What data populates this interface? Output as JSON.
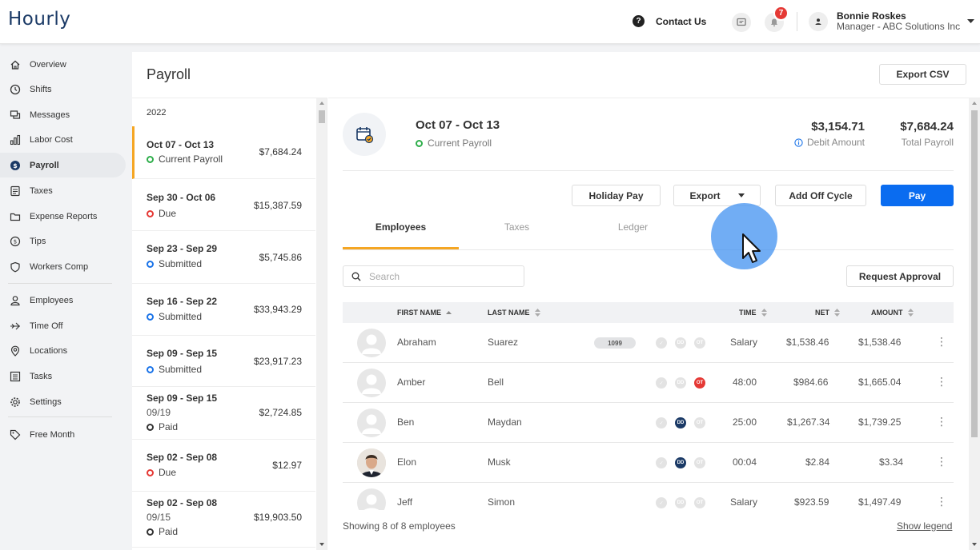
{
  "header": {
    "logo": "Hourly",
    "contact_label": "Contact Us",
    "notification_count": "7",
    "user_name": "Bonnie Roskes",
    "user_role": "Manager - ABC Solutions Inc"
  },
  "sidebar": {
    "items": [
      {
        "label": "Overview",
        "icon": "house-icon"
      },
      {
        "label": "Shifts",
        "icon": "clock-icon"
      },
      {
        "label": "Messages",
        "icon": "chat-icon"
      },
      {
        "label": "Labor Cost",
        "icon": "bar-chart-icon"
      },
      {
        "label": "Payroll",
        "icon": "dollar-circle-icon"
      },
      {
        "label": "Taxes",
        "icon": "document-icon"
      },
      {
        "label": "Expense Reports",
        "icon": "folder-icon"
      },
      {
        "label": "Tips",
        "icon": "coin-icon"
      },
      {
        "label": "Workers Comp",
        "icon": "shield-icon"
      },
      {
        "label": "Employees",
        "icon": "person-icon"
      },
      {
        "label": "Time Off",
        "icon": "plane-icon"
      },
      {
        "label": "Locations",
        "icon": "pin-icon"
      },
      {
        "label": "Tasks",
        "icon": "list-icon"
      },
      {
        "label": "Settings",
        "icon": "gear-icon"
      },
      {
        "label": "Free Month",
        "icon": "tag-icon"
      }
    ],
    "active_item": "Payroll"
  },
  "page": {
    "title": "Payroll",
    "export_csv_label": "Export CSV"
  },
  "periods": {
    "year": "2022",
    "items": [
      {
        "range": "Oct 07 - Oct 13",
        "sub": "",
        "status": "Current Payroll",
        "status_color": "#2fae4b",
        "amount": "$7,684.24"
      },
      {
        "range": "Sep 30 - Oct 06",
        "sub": "",
        "status": "Due",
        "status_color": "#e53935",
        "amount": "$15,387.59"
      },
      {
        "range": "Sep 23 - Sep 29",
        "sub": "",
        "status": "Submitted",
        "status_color": "#1a73e8",
        "amount": "$5,745.86"
      },
      {
        "range": "Sep 16 - Sep 22",
        "sub": "",
        "status": "Submitted",
        "status_color": "#1a73e8",
        "amount": "$33,943.29"
      },
      {
        "range": "Sep 09 - Sep 15",
        "sub": "",
        "status": "Submitted",
        "status_color": "#1a73e8",
        "amount": "$23,917.23"
      },
      {
        "range": "Sep 09 - Sep 15",
        "sub": "09/19",
        "status": "Paid",
        "status_color": "#333333",
        "amount": "$2,724.85"
      },
      {
        "range": "Sep 02 - Sep 08",
        "sub": "",
        "status": "Due",
        "status_color": "#e53935",
        "amount": "$12.97"
      },
      {
        "range": "Sep 02 - Sep 08",
        "sub": "09/15",
        "status": "Paid",
        "status_color": "#333333",
        "amount": "$19,903.50"
      }
    ]
  },
  "detail": {
    "title": "Oct 07 - Oct 13",
    "status": "Current Payroll",
    "debit_amount": "$3,154.71",
    "debit_label": "Debit Amount",
    "total_payroll": "$7,684.24",
    "total_label": "Total Payroll",
    "buttons": {
      "holiday_pay": "Holiday Pay",
      "export": "Export",
      "add_off_cycle": "Add Off Cycle",
      "pay": "Pay",
      "request_approval": "Request Approval"
    },
    "tabs": [
      "Employees",
      "Taxes",
      "Ledger"
    ],
    "active_tab": "Employees",
    "search_placeholder": "Search",
    "columns": {
      "first_name": "FIRST NAME",
      "last_name": "LAST NAME",
      "time": "TIME",
      "net": "NET",
      "amount": "AMOUNT"
    },
    "employees": [
      {
        "first": "Abraham",
        "last": "Suarez",
        "tag": "1099",
        "badges": [],
        "time": "Salary",
        "net": "$1,538.46",
        "amount": "$1,538.46",
        "photo": false
      },
      {
        "first": "Amber",
        "last": "Bell",
        "tag": "",
        "badges": [
          "OT"
        ],
        "time": "48:00",
        "net": "$984.66",
        "amount": "$1,665.04",
        "photo": false
      },
      {
        "first": "Ben",
        "last": "Maydan",
        "tag": "",
        "badges": [
          "DD"
        ],
        "time": "25:00",
        "net": "$1,267.34",
        "amount": "$1,739.25",
        "photo": false
      },
      {
        "first": "Elon",
        "last": "Musk",
        "tag": "",
        "badges": [
          "DD"
        ],
        "time": "00:04",
        "net": "$2.84",
        "amount": "$3.34",
        "photo": true
      },
      {
        "first": "Jeff",
        "last": "Simon",
        "tag": "",
        "badges": [],
        "time": "Salary",
        "net": "$923.59",
        "amount": "$1,497.49",
        "photo": false
      }
    ],
    "footer_text": "Showing 8 of 8 employees",
    "show_legend": "Show legend"
  }
}
